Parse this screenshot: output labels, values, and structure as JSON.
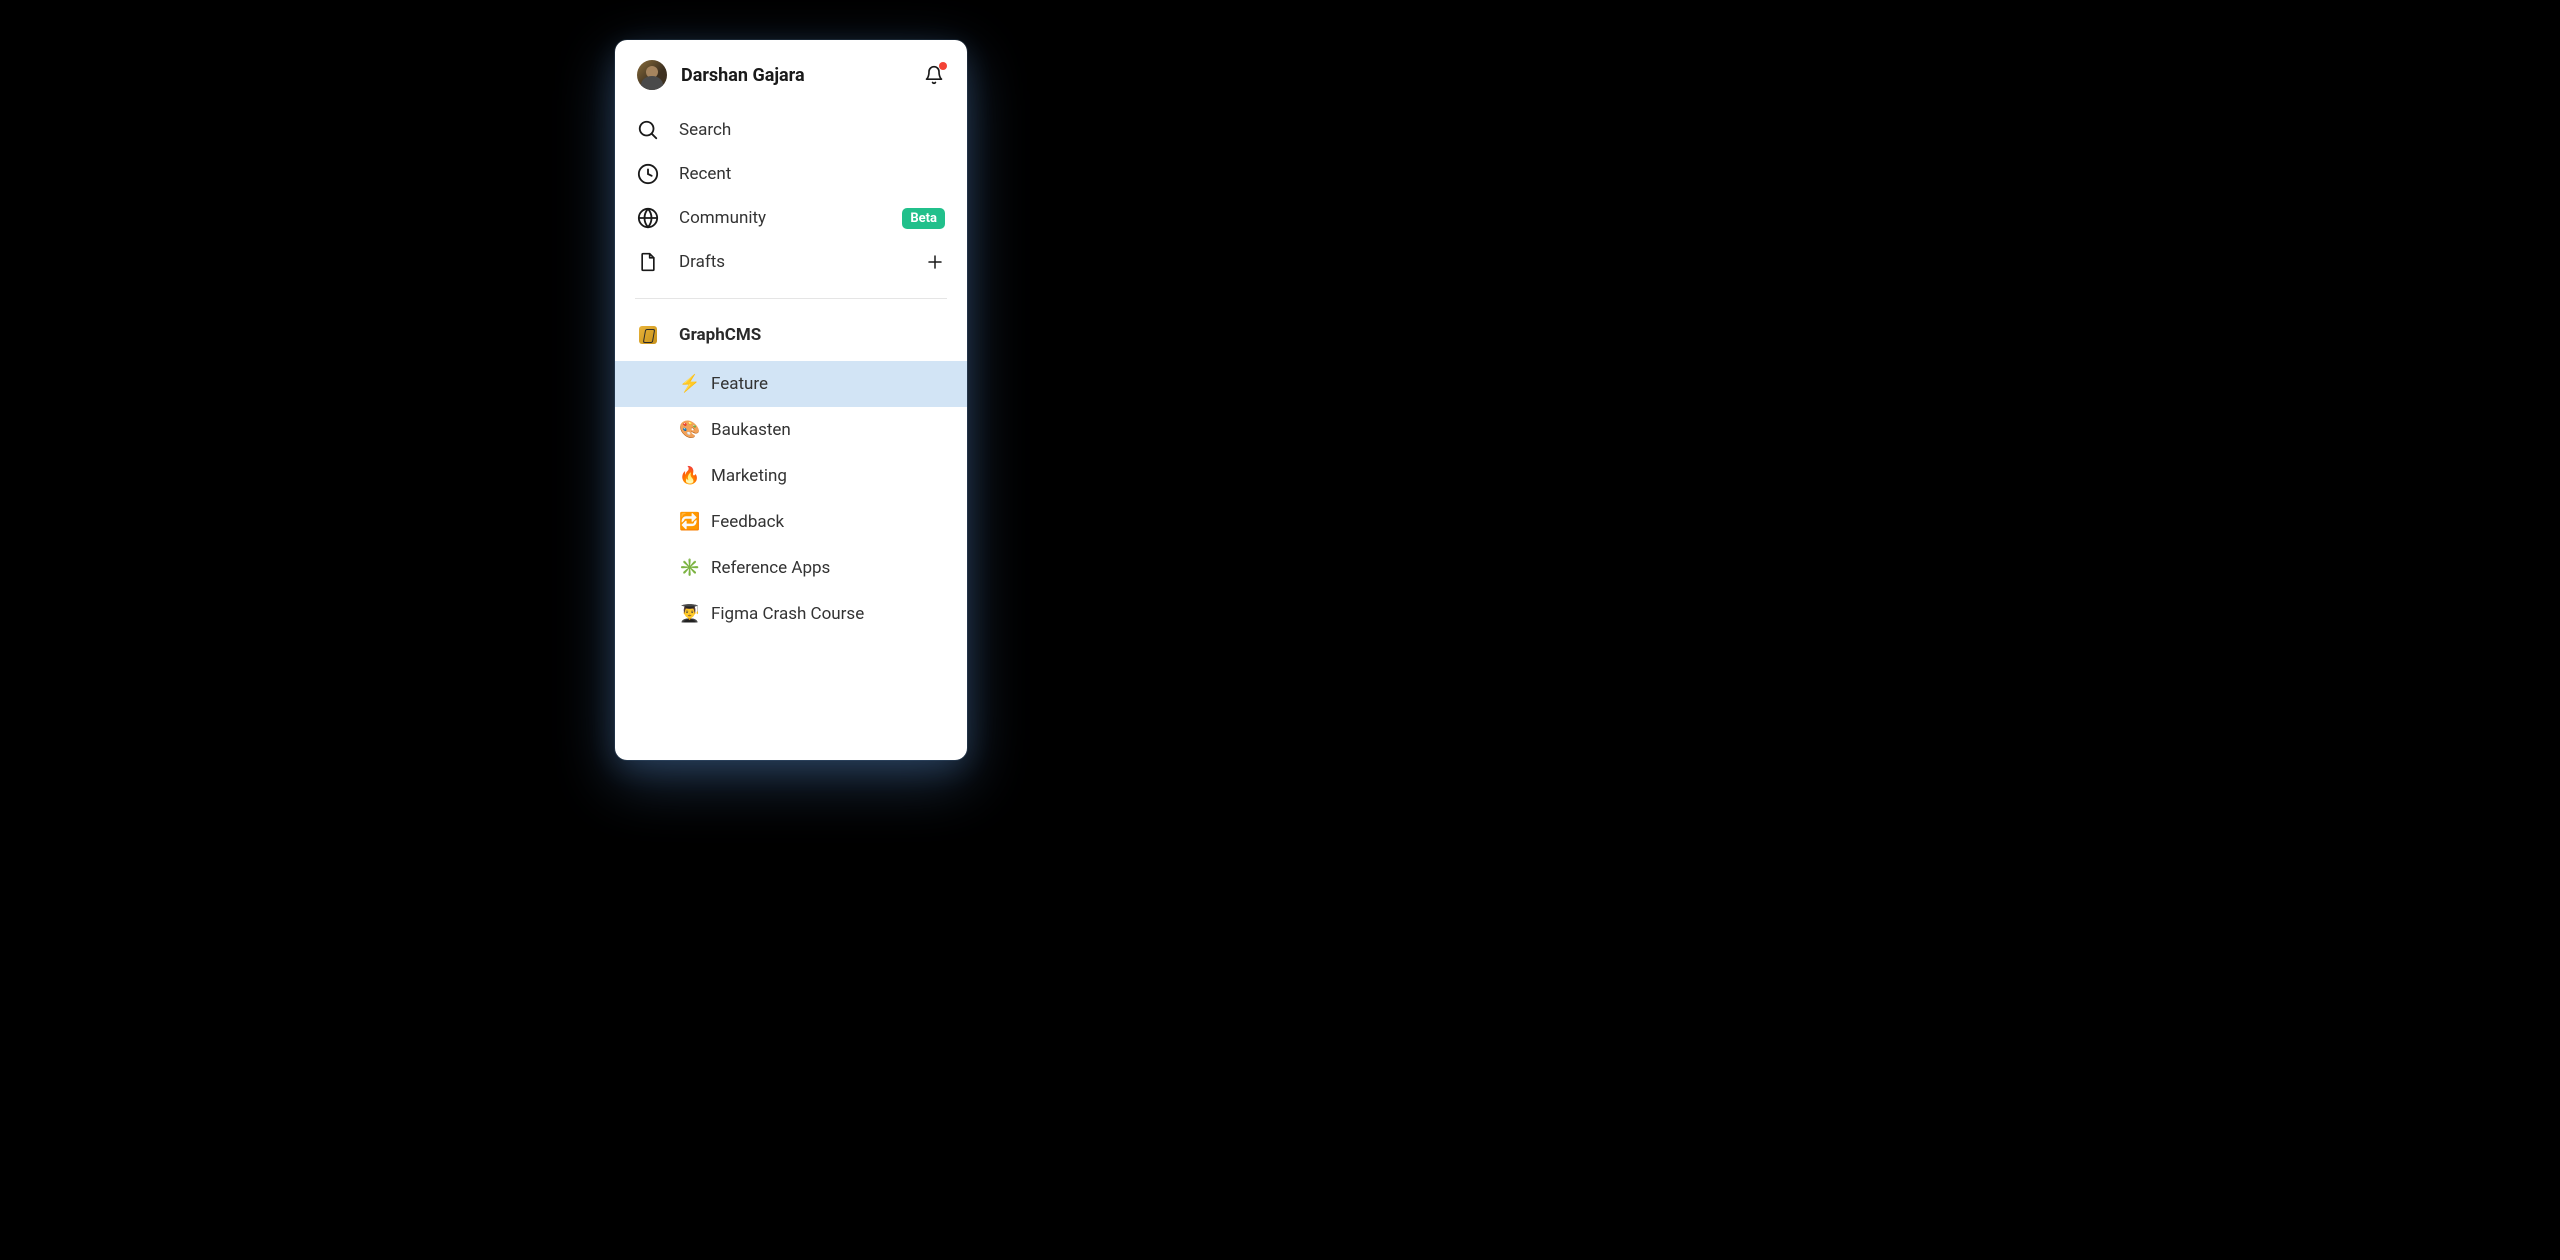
{
  "user": {
    "name": "Darshan Gajara",
    "has_notification": true
  },
  "nav": [
    {
      "icon": "search",
      "label": "Search"
    },
    {
      "icon": "clock",
      "label": "Recent"
    },
    {
      "icon": "globe",
      "label": "Community",
      "badge": "Beta"
    },
    {
      "icon": "file",
      "label": "Drafts",
      "action": "plus"
    }
  ],
  "team": {
    "name": "GraphCMS",
    "projects": [
      {
        "emoji": "⚡",
        "label": "Feature",
        "selected": true
      },
      {
        "emoji": "🎨",
        "label": "Baukasten",
        "selected": false
      },
      {
        "emoji": "🔥",
        "label": "Marketing",
        "selected": false
      },
      {
        "emoji": "🔁",
        "label": "Feedback",
        "selected": false
      },
      {
        "emoji": "✳️",
        "label": "Reference Apps",
        "selected": false
      },
      {
        "emoji": "👨‍🎓",
        "label": "Figma Crash Course",
        "selected": false
      }
    ]
  }
}
